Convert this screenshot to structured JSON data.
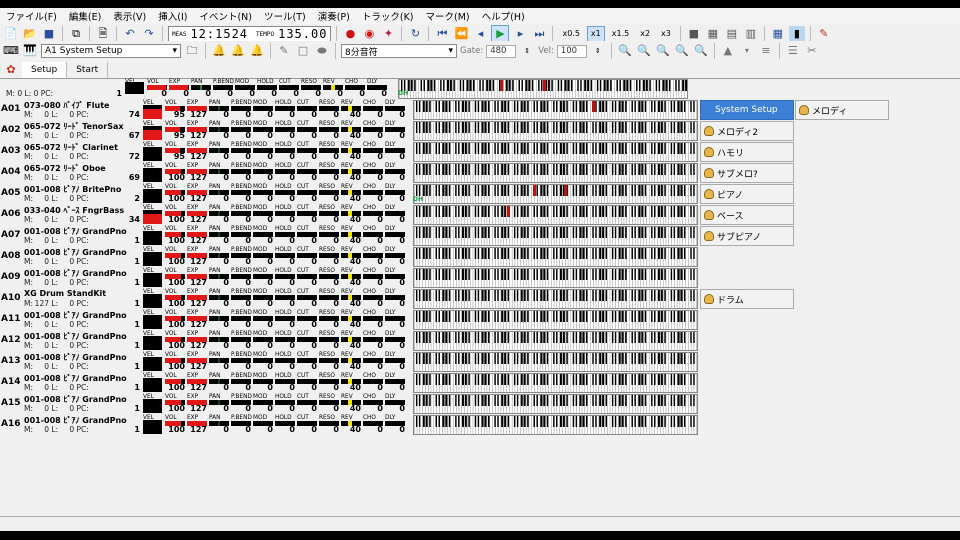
{
  "menu": [
    "ファイル(F)",
    "編集(E)",
    "表示(V)",
    "挿入(I)",
    "イベント(N)",
    "ツール(T)",
    "演奏(P)",
    "トラック(K)",
    "マーク(M)",
    "ヘルプ(H)"
  ],
  "transport": {
    "meas_label": "MEAS",
    "position": "12:1524",
    "tempo_label": "TEMPO",
    "tempo": "135.00",
    "speeds": [
      "x0.5",
      "x1",
      "x1.5",
      "x2",
      "x3"
    ],
    "active_speed": "x1"
  },
  "toolbar2": {
    "track_select": "A1 System Setup",
    "note_length": "8分音符",
    "gate_label": "Gate:",
    "gate": "480",
    "vel_label": "Vel:",
    "vel": "100"
  },
  "tabs": [
    "Setup",
    "Start"
  ],
  "param_labels": [
    "VEL",
    "VOL",
    "EXP",
    "PAN",
    "P.BEND",
    "MOD",
    "HOLD",
    "CUT",
    "RESO",
    "REV",
    "CHO",
    "DLY"
  ],
  "master": {
    "ml_text": "M:   0  L:   0  PC:",
    "pc": "1",
    "values": [
      "",
      "0",
      "0",
      "0",
      "0",
      "0",
      "0",
      "0",
      "0",
      "0",
      "0",
      "0"
    ],
    "dh": "DH"
  },
  "tracks": [
    {
      "id": "A01",
      "name": "073-080 ﾊﾟｲﾌﾟ Flute",
      "m": "0",
      "l": "0",
      "pc": "74",
      "vel": true,
      "vol": "95",
      "exp": "127",
      "rev": "40",
      "notes": [
        0.63
      ]
    },
    {
      "id": "A02",
      "name": "065-072 ﾘｰﾄﾞ TenorSax",
      "m": "0",
      "l": "0",
      "pc": "67",
      "vel": true,
      "vol": "95",
      "exp": "127",
      "rev": "40",
      "notes": []
    },
    {
      "id": "A03",
      "name": "065-072 ﾘｰﾄﾞ Clarinet",
      "m": "0",
      "l": "0",
      "pc": "72",
      "vel": false,
      "vol": "95",
      "exp": "127",
      "rev": "40",
      "notes": []
    },
    {
      "id": "A04",
      "name": "065-072 ﾘｰﾄﾞ Oboe",
      "m": "0",
      "l": "0",
      "pc": "69",
      "vel": false,
      "vol": "100",
      "exp": "127",
      "rev": "40",
      "notes": []
    },
    {
      "id": "A05",
      "name": "001-008 ﾋﾟｱﾉ BritePno",
      "m": "0",
      "l": "0",
      "pc": "2",
      "vel": false,
      "vol": "100",
      "exp": "127",
      "rev": "40",
      "notes": [
        0.42,
        0.53
      ],
      "dh": "DH"
    },
    {
      "id": "A06",
      "name": "033-040 ﾍﾞｰｽ FngrBass",
      "m": "0",
      "l": "0",
      "pc": "34",
      "vel": true,
      "vol": "100",
      "exp": "127",
      "rev": "40",
      "notes": [
        0.33
      ]
    },
    {
      "id": "A07",
      "name": "001-008 ﾋﾟｱﾉ GrandPno",
      "m": "0",
      "l": "0",
      "pc": "1",
      "vel": false,
      "vol": "100",
      "exp": "127",
      "rev": "40",
      "notes": []
    },
    {
      "id": "A08",
      "name": "001-008 ﾋﾟｱﾉ GrandPno",
      "m": "0",
      "l": "0",
      "pc": "1",
      "vel": false,
      "vol": "100",
      "exp": "127",
      "rev": "40",
      "notes": []
    },
    {
      "id": "A09",
      "name": "001-008 ﾋﾟｱﾉ GrandPno",
      "m": "0",
      "l": "0",
      "pc": "1",
      "vel": false,
      "vol": "100",
      "exp": "127",
      "rev": "40",
      "notes": []
    },
    {
      "id": "A10",
      "name": "XG Drum StandKit",
      "m": "127",
      "l": "0",
      "pc": "1",
      "vel": false,
      "vol": "100",
      "exp": "127",
      "rev": "40",
      "notes": []
    },
    {
      "id": "A11",
      "name": "001-008 ﾋﾟｱﾉ GrandPno",
      "m": "0",
      "l": "0",
      "pc": "1",
      "vel": false,
      "vol": "100",
      "exp": "127",
      "rev": "40",
      "notes": []
    },
    {
      "id": "A12",
      "name": "001-008 ﾋﾟｱﾉ GrandPno",
      "m": "0",
      "l": "0",
      "pc": "1",
      "vel": false,
      "vol": "100",
      "exp": "127",
      "rev": "40",
      "notes": []
    },
    {
      "id": "A13",
      "name": "001-008 ﾋﾟｱﾉ GrandPno",
      "m": "0",
      "l": "0",
      "pc": "1",
      "vel": false,
      "vol": "100",
      "exp": "127",
      "rev": "40",
      "notes": []
    },
    {
      "id": "A14",
      "name": "001-008 ﾋﾟｱﾉ GrandPno",
      "m": "0",
      "l": "0",
      "pc": "1",
      "vel": false,
      "vol": "100",
      "exp": "127",
      "rev": "40",
      "notes": []
    },
    {
      "id": "A15",
      "name": "001-008 ﾋﾟｱﾉ GrandPno",
      "m": "0",
      "l": "0",
      "pc": "1",
      "vel": false,
      "vol": "100",
      "exp": "127",
      "rev": "40",
      "notes": []
    },
    {
      "id": "A16",
      "name": "001-008 ﾋﾟｱﾉ GrandPno",
      "m": "0",
      "l": "0",
      "pc": "1",
      "vel": false,
      "vol": "100",
      "exp": "127",
      "rev": "40",
      "notes": []
    }
  ],
  "side_list": [
    {
      "label": "System Setup",
      "selected": true,
      "row": 0
    },
    {
      "label": "メロディ",
      "selected": false,
      "row": 0,
      "col2": true
    },
    {
      "label": "メロディ2",
      "selected": false,
      "row": 1
    },
    {
      "label": "ハモリ",
      "selected": false,
      "row": 2
    },
    {
      "label": "サブメロ?",
      "selected": false,
      "row": 3
    },
    {
      "label": "ピアノ",
      "selected": false,
      "row": 4
    },
    {
      "label": "ベース",
      "selected": false,
      "row": 5
    },
    {
      "label": "サブピアノ",
      "selected": false,
      "row": 6
    },
    {
      "label": "ドラム",
      "selected": false,
      "row": 9
    }
  ],
  "colors": {
    "accent": "#3c7fd6",
    "vel_red": "#e01818",
    "rev_yellow": "#f2e200",
    "note_red": "#c01010"
  }
}
